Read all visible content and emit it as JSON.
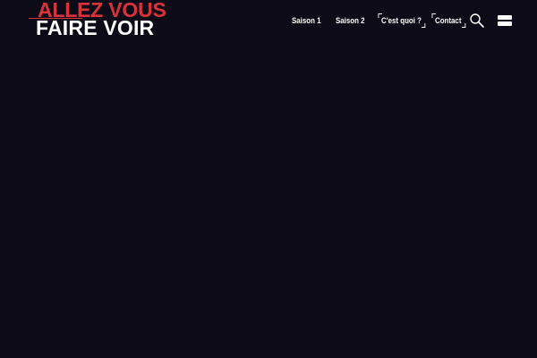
{
  "logo": {
    "line1": "ALLEZ VOUS",
    "line2": "FAIRE VOIR",
    "accent_color": "#d9323a"
  },
  "nav": {
    "items": [
      {
        "label": "Saison 1",
        "bracketed": false
      },
      {
        "label": "Saison 2",
        "bracketed": false
      },
      {
        "label": "C'est quoi ?",
        "bracketed": true
      },
      {
        "label": "Contact",
        "bracketed": true
      }
    ]
  },
  "icons": {
    "search": "search-icon",
    "menu": "menu-icon"
  },
  "colors": {
    "background": "#0d0b18",
    "text": "#ffffff",
    "accent": "#d9323a"
  }
}
